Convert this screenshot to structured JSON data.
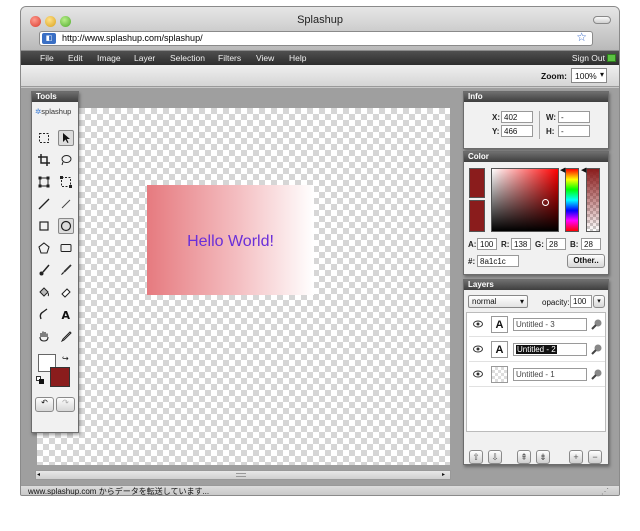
{
  "window": {
    "title": "Splashup"
  },
  "browser": {
    "url": "http://www.splashup.com/splashup/",
    "status": "www.splashup.com からデータを転送しています..."
  },
  "menu": {
    "items": [
      "File",
      "Edit",
      "Image",
      "Layer",
      "Selection",
      "Filters",
      "View",
      "Help"
    ],
    "signout": "Sign Out"
  },
  "toolbar": {
    "zoom_label": "Zoom:",
    "zoom_value": "100%"
  },
  "canvas": {
    "text": "Hello World!"
  },
  "tools": {
    "title": "Tools",
    "logo": "splashup"
  },
  "info": {
    "title": "Info",
    "x_label": "X:",
    "x": "402",
    "y_label": "Y:",
    "y": "466",
    "w_label": "W:",
    "w": "-",
    "h_label": "H:",
    "h": "-"
  },
  "color": {
    "title": "Color",
    "a_label": "A:",
    "a": "100",
    "r_label": "R:",
    "r": "138",
    "g_label": "G:",
    "g": "28",
    "b_label": "B:",
    "b": "28",
    "hex_label": "#:",
    "hex": "8a1c1c",
    "button": "Other..",
    "swatch": "#8a1c1c"
  },
  "layers": {
    "title": "Layers",
    "blend": "normal",
    "opacity_label": "opacity:",
    "opacity": "100",
    "items": [
      {
        "name": "Untitled - 3",
        "type": "A"
      },
      {
        "name": "Untitled - 2",
        "type": "A"
      },
      {
        "name": "Untitled - 1",
        "type": ""
      }
    ]
  }
}
